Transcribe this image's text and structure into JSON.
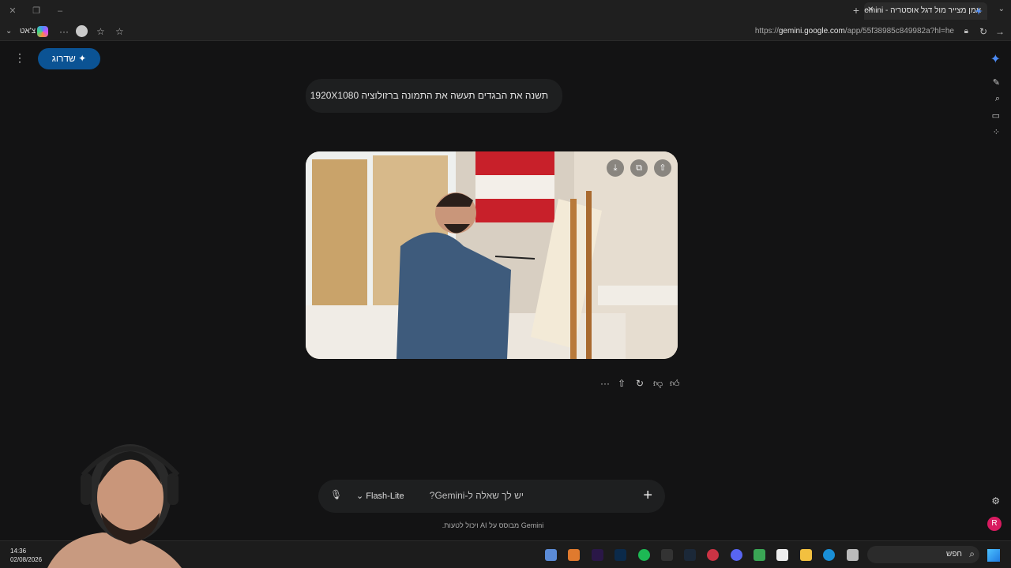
{
  "browser": {
    "tab_title": "אמן מצייר מול דגל אוסטריה - Gemini",
    "url_prefix": "https://",
    "url_domain": "gemini.google.com",
    "url_path": "/app/55f38985c849982a?hl=he",
    "chat_label": "צ'אט"
  },
  "app": {
    "upgrade_label": "✦ שדרוג",
    "user_message": "תשנה את הבגדים תעשה את התמונה ברזולוציה 1920X1080",
    "input_placeholder": "יש לך שאלה ל-Gemini?",
    "model_label": "Flash-Lite",
    "disclaimer": "Gemini מבוסס על AI ויכול לטעות.",
    "account_initial": "R",
    "accent_color": "#0b5394"
  },
  "taskbar": {
    "time": "14:36",
    "date": "02/08/2026",
    "search_label": "חפש"
  }
}
